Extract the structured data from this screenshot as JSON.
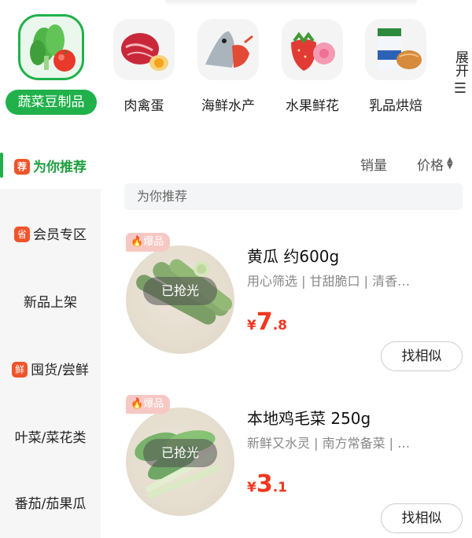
{
  "categories": [
    {
      "label": "蔬菜豆制品",
      "icon": "vegetables-icon",
      "active": true
    },
    {
      "label": "肉禽蛋",
      "icon": "meat-egg-icon",
      "active": false
    },
    {
      "label": "海鲜水产",
      "icon": "seafood-icon",
      "active": false
    },
    {
      "label": "水果鲜花",
      "icon": "fruit-flower-icon",
      "active": false
    },
    {
      "label": "乳品烘焙",
      "icon": "dairy-bakery-icon",
      "active": false
    }
  ],
  "expand": {
    "label": "展开",
    "icon": "menu-lines-icon"
  },
  "sidebar": {
    "items": [
      {
        "label": "为你推荐",
        "badge": "荐",
        "active": true
      },
      {
        "label": "会员专区",
        "badge": "省",
        "active": false
      },
      {
        "label": "新品上架",
        "badge": "",
        "active": false
      },
      {
        "label": "囤货/尝鲜",
        "badge": "鲜",
        "active": false
      },
      {
        "label": "叶菜/菜花类",
        "badge": "",
        "active": false
      },
      {
        "label": "番茄/茄果瓜",
        "badge": "",
        "active": false
      }
    ]
  },
  "sort": {
    "sales": "销量",
    "price": "价格"
  },
  "section_title": "为你推荐",
  "products": [
    {
      "badge": "爆品",
      "status": "已抢光",
      "title": "黄瓜  约600g",
      "desc": "用心筛选 | 甘甜脆口 | 清香…",
      "price_symbol": "¥",
      "price_int": "7",
      "price_dec": ".8",
      "action": "找相似",
      "image": "cucumber-image"
    },
    {
      "badge": "爆品",
      "status": "已抢光",
      "title": "本地鸡毛菜  250g",
      "desc": "新鲜又水灵 | 南方常备菜 | …",
      "price_symbol": "¥",
      "price_int": "3",
      "price_dec": ".1",
      "action": "找相似",
      "image": "leafy-greens-image"
    }
  ],
  "colors": {
    "accent": "#21b14b",
    "price": "#f0371f",
    "badge": "#f0542a"
  }
}
